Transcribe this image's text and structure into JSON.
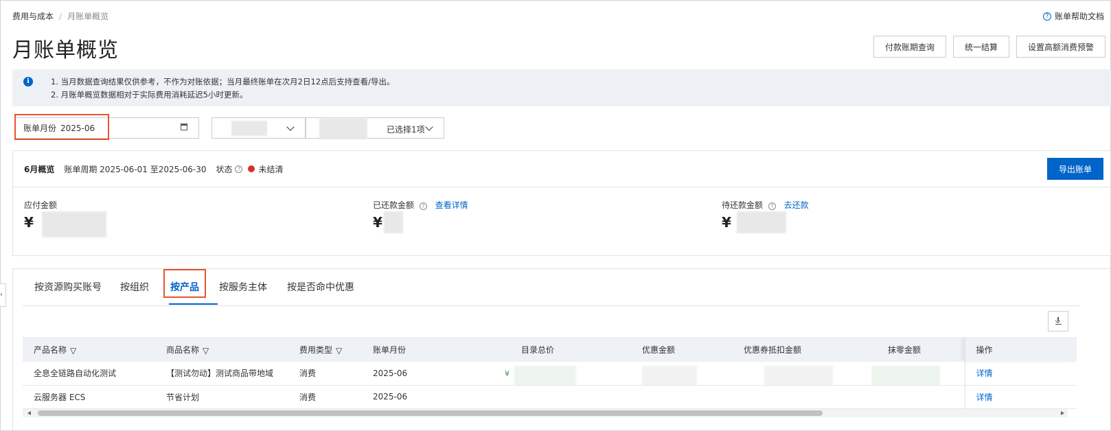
{
  "breadcrumb": {
    "root": "费用与成本",
    "current": "月账单概览"
  },
  "help_link": "账单帮助文档",
  "page_title": "月账单概览",
  "top_actions": [
    "付款账期查询",
    "统一结算",
    "设置高额消费预警"
  ],
  "notice": {
    "line1": "1. 当月数据查询结果仅供参考，不作为对账依据；当月最终账单在次月2日12点后支持查看/导出。",
    "line2": "2. 月账单概览数据相对于实际费用消耗延迟5小时更新。"
  },
  "filters": {
    "month_label": "账单月份",
    "month_value": "2025-06",
    "select2_text": "已选择1项"
  },
  "overview": {
    "month": "6月概览",
    "period": "账单周期 2025-06-01 至2025-06-30",
    "status_label": "状态",
    "status_value": "未结清",
    "export_button": "导出账单",
    "payable_label": "应付金额",
    "paid_label": "已还款金额",
    "paid_link": "查看详情",
    "pending_label": "待还款金额",
    "pending_link": "去还款",
    "currency": "¥"
  },
  "tabs": [
    "按资源购买账号",
    "按组织",
    "按产品",
    "按服务主体",
    "按是否命中优惠"
  ],
  "active_tab": "按产品",
  "table": {
    "headers": [
      "产品名称",
      "商品名称",
      "费用类型",
      "账单月份",
      "目录总价",
      "优惠金额",
      "优惠券抵扣金额",
      "抹零金额",
      "操作"
    ],
    "rows": [
      {
        "product": "全息全链路自动化测试",
        "commodity": "【测试勿动】测试商品带地域",
        "fee_type": "消费",
        "month": "2025-06",
        "list_price_prefix": "¥",
        "op": "详情"
      },
      {
        "product": "云服务器 ECS",
        "commodity": "节省计划",
        "fee_type": "消费",
        "month": "2025-06",
        "list_price_prefix": "",
        "op": "详情"
      }
    ]
  },
  "colors": {
    "accent": "#0064c8",
    "highlight": "#e8532c",
    "status_red": "#d93026"
  }
}
